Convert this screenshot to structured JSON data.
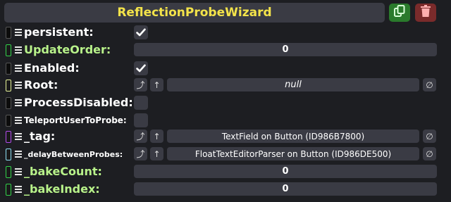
{
  "header": {
    "title": "ReflectionProbeWizard"
  },
  "icons": {
    "copy": "copy-icon",
    "delete": "trash-icon",
    "drag": "drag-handle-icon",
    "clear": "clear-reference-icon"
  },
  "colors": {
    "title": "#f3e34a",
    "copy_button": "#2a7a2c",
    "delete_button": "#7a2b2b",
    "green_label": "#b8f28a"
  },
  "fields": [
    {
      "label": "persistent:",
      "kind": "checkbox",
      "checked": true,
      "tag_color": "#101010"
    },
    {
      "label": "UpdateOrder:",
      "kind": "number",
      "value": "0",
      "tag_color": "#32d34a"
    },
    {
      "label": "Enabled:",
      "kind": "checkbox",
      "checked": true,
      "tag_color": "#101010"
    },
    {
      "label": "Root:",
      "kind": "reference",
      "value": "null",
      "tag_color": "#e8f59a"
    },
    {
      "label": "ProcessDisabled:",
      "kind": "checkbox",
      "checked": false,
      "tag_color": "#101010"
    },
    {
      "label": "TeleportUserToProbe:",
      "kind": "checkbox",
      "checked": false,
      "tag_color": "#101010"
    },
    {
      "label": "_tag:",
      "kind": "reference",
      "value": "TextField on Button (ID986B7800)",
      "tag_color": "#b44cf0"
    },
    {
      "label": "_delayBetweenProbes:",
      "kind": "reference",
      "value": "FloatTextEditorParser on Button (ID986DE500)",
      "tag_color": "#8ee0f5"
    },
    {
      "label": "_bakeCount:",
      "kind": "number",
      "value": "0",
      "tag_color": "#32d34a"
    },
    {
      "label": "_bakeIndex:",
      "kind": "number",
      "value": "0",
      "tag_color": "#32d34a"
    }
  ]
}
